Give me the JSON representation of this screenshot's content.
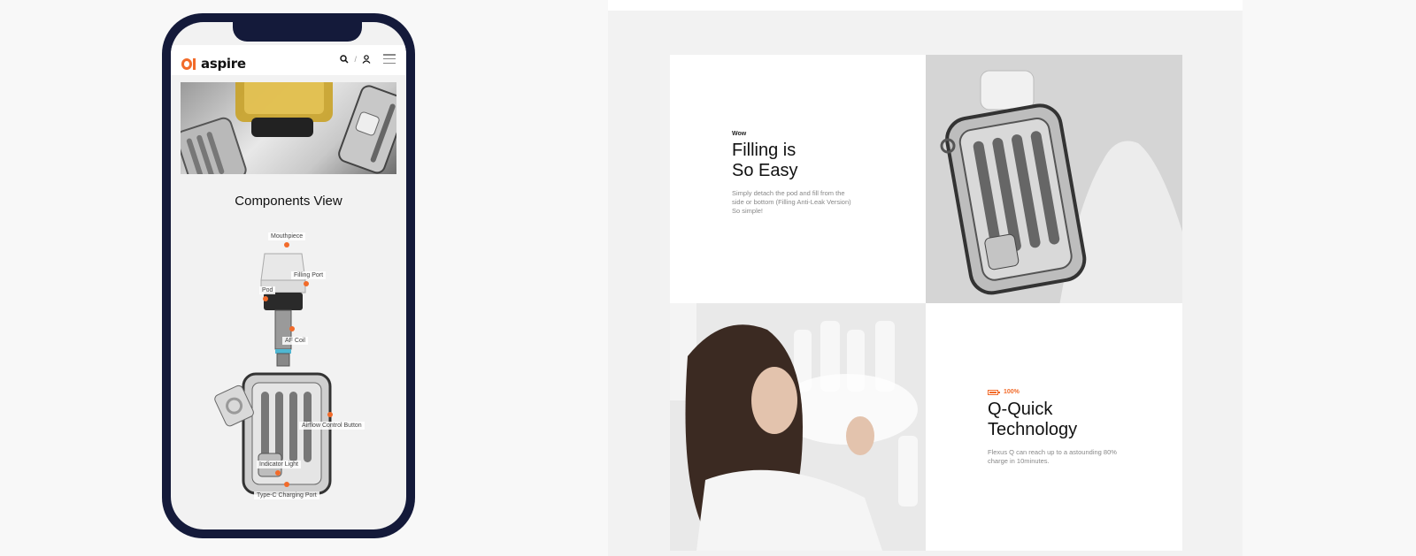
{
  "mobile": {
    "brand": "aspire",
    "separator": "/",
    "section_title": "Components View",
    "components": [
      {
        "key": "mouthpiece",
        "label": "Mouthpiece"
      },
      {
        "key": "filling_port",
        "label": "Filling Port"
      },
      {
        "key": "pod",
        "label": "Pod"
      },
      {
        "key": "af_coil",
        "label": "AF Coil"
      },
      {
        "key": "airflow_button",
        "label": "Airflow Control Button"
      },
      {
        "key": "indicator_light",
        "label": "Indicator Light"
      },
      {
        "key": "charging_port",
        "label": "Type-C Charging Port"
      }
    ]
  },
  "features": {
    "filling": {
      "eyebrow": "Wow",
      "title_line1": "Filling is",
      "title_line2": "So Easy",
      "desc_line1": "Simply detach the pod and fill from the",
      "desc_line2": "side or bottom (Filling Anti-Leak Version)",
      "desc_line3": "So simple!"
    },
    "charging": {
      "badge": "100%",
      "title_line1": "Q-Quick",
      "title_line2": "Technology",
      "desc_line1": "Flexus Q can reach up to a astounding 80%",
      "desc_line2": "charge in 10minutes."
    }
  },
  "colors": {
    "accent": "#f26b2a",
    "phone_frame": "#141a3a"
  }
}
